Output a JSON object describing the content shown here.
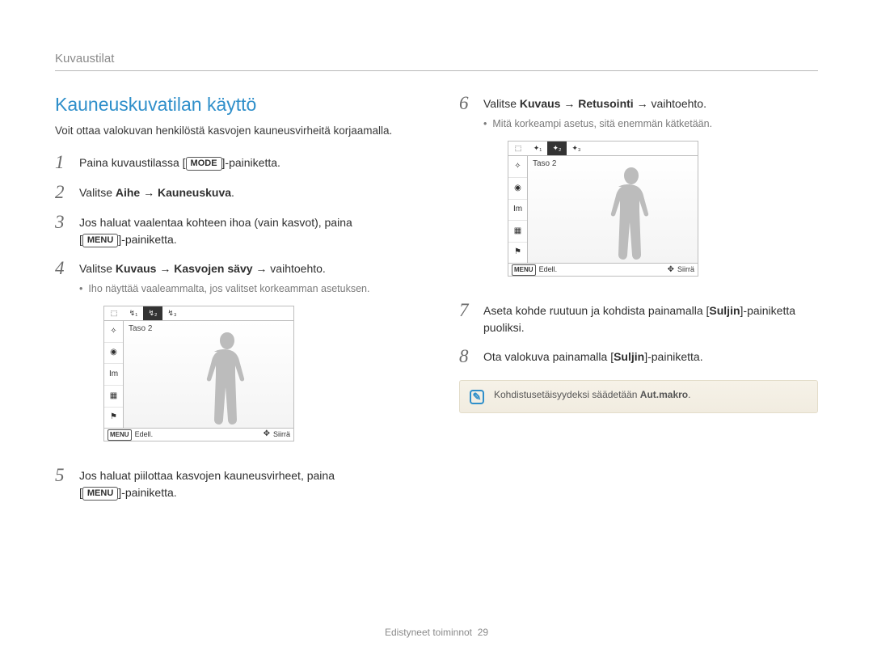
{
  "section": "Kuvaustilat",
  "heading": "Kauneuskuvatilan käyttö",
  "intro": "Voit ottaa valokuvan henkilöstä kasvojen kauneusvirheitä korjaamalla.",
  "mode_tag": "MODE",
  "menu_tag": "MENU",
  "steps": {
    "s1": {
      "num": "1",
      "before": "Paina kuvaustilassa [",
      "after": "]-painiketta."
    },
    "s2": {
      "num": "2",
      "pre": "Valitse ",
      "b1": "Aihe",
      "arr1": " → ",
      "b2": "Kauneuskuva",
      "post": "."
    },
    "s3": {
      "num": "3",
      "line1": "Jos haluat vaalentaa kohteen ihoa (vain kasvot), paina",
      "line2a": "[",
      "line2b": "]-painiketta."
    },
    "s4": {
      "num": "4",
      "pre": "Valitse ",
      "b1": "Kuvaus",
      "arr1": " → ",
      "b2": "Kasvojen sävy",
      "arr2": " → vaihtoehto.",
      "sub": "Iho näyttää vaaleammalta, jos valitset korkeamman asetuksen."
    },
    "s5": {
      "num": "5",
      "line1": "Jos haluat piilottaa kasvojen kauneusvirheet, paina",
      "line2a": "[",
      "line2b": "]-painiketta."
    },
    "s6": {
      "num": "6",
      "pre": "Valitse ",
      "b1": "Kuvaus",
      "arr1": " → ",
      "b2": "Retusointi",
      "arr2": " → vaihtoehto.",
      "sub": "Mitä korkeampi asetus, sitä enemmän kätketään."
    },
    "s7": {
      "num": "7",
      "pre": "Aseta kohde ruutuun ja kohdista painamalla [",
      "b1": "Suljin",
      "post": "]-painiketta puoliksi."
    },
    "s8": {
      "num": "8",
      "pre": "Ota valokuva painamalla [",
      "b1": "Suljin",
      "post": "]-painiketta."
    }
  },
  "screen": {
    "label": "Taso 2",
    "back_btn": "MENU",
    "back": "Edell.",
    "move": "Siirrä",
    "side_icons": [
      "✧",
      "◉",
      "Im",
      "▦",
      "⚑"
    ],
    "top_a": [
      "↯₁",
      "↯₂",
      "↯₃"
    ],
    "top_b": [
      "✦₁",
      "✦₂",
      "✦₃"
    ]
  },
  "note": {
    "pre": "Kohdistusetäisyydeksi säädetään ",
    "b": "Aut.makro",
    "post": "."
  },
  "footer": {
    "label": "Edistyneet toiminnot",
    "page": "29"
  }
}
